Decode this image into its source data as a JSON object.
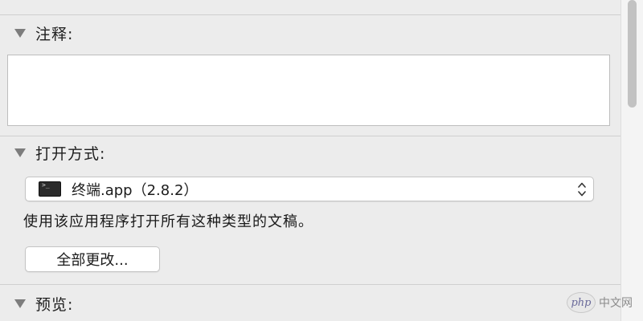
{
  "comments_section": {
    "title": "注释:",
    "text": ""
  },
  "open_with_section": {
    "title": "打开方式:",
    "selected_app": "终端.app（2.8.2）",
    "description": "使用该应用程序打开所有这种类型的文稿。",
    "change_all_label": "全部更改..."
  },
  "preview_section": {
    "title": "预览:"
  },
  "watermark": {
    "logo": "php",
    "text": "中文网"
  },
  "icons": {
    "disclosure": "disclosure-triangle-icon",
    "terminal": "terminal-app-icon",
    "stepper": "up-down-chevron-icon",
    "terminal_prompt": ">_"
  }
}
